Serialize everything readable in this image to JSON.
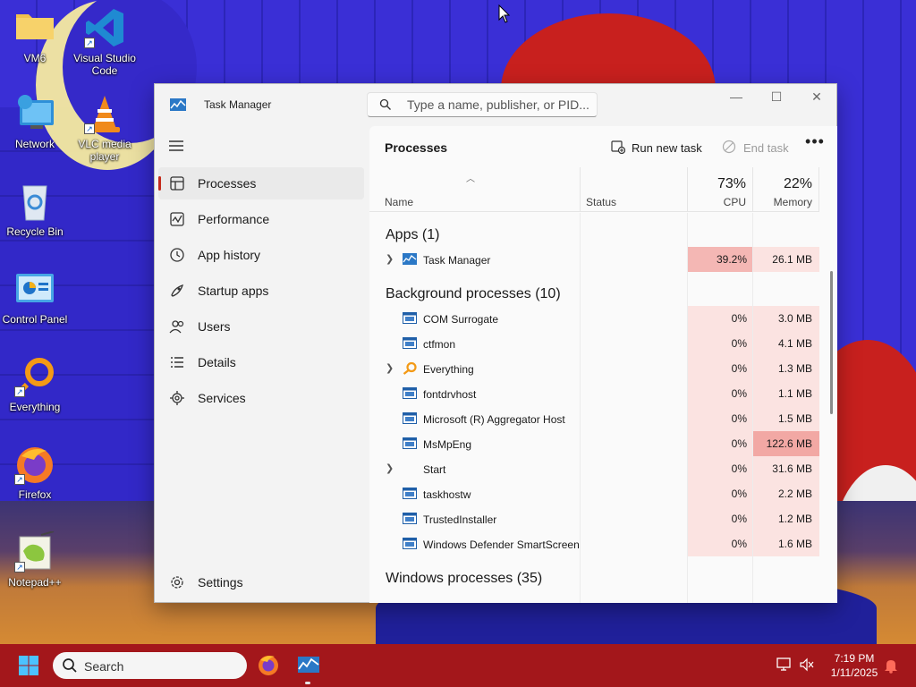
{
  "desktop": {
    "icons": [
      {
        "label": "VM6"
      },
      {
        "label": "Visual Studio Code"
      },
      {
        "label": "Network"
      },
      {
        "label": "VLC media player"
      },
      {
        "label": "Recycle Bin"
      },
      {
        "label": "Control Panel"
      },
      {
        "label": "Everything"
      },
      {
        "label": "Firefox"
      },
      {
        "label": "Notepad++"
      }
    ]
  },
  "window": {
    "title": "Task Manager",
    "search_placeholder": "Type a name, publisher, or PID...",
    "controls": {
      "minimize": "—",
      "maximize": "☐",
      "close": "✕"
    }
  },
  "sidebar": {
    "items": [
      {
        "label": "Processes",
        "icon": "processes-icon",
        "active": true
      },
      {
        "label": "Performance",
        "icon": "performance-icon"
      },
      {
        "label": "App history",
        "icon": "history-icon"
      },
      {
        "label": "Startup apps",
        "icon": "startup-icon"
      },
      {
        "label": "Users",
        "icon": "users-icon"
      },
      {
        "label": "Details",
        "icon": "details-icon"
      },
      {
        "label": "Services",
        "icon": "services-icon"
      }
    ],
    "settings_label": "Settings"
  },
  "content": {
    "page_title": "Processes",
    "run_new_task": "Run new task",
    "end_task": "End task",
    "more": "•••"
  },
  "table": {
    "headers": {
      "name": "Name",
      "status": "Status",
      "cpu_pct": "73%",
      "cpu": "CPU",
      "mem_pct": "22%",
      "memory": "Memory"
    },
    "groups": {
      "apps": "Apps (1)",
      "background": "Background processes (10)",
      "windows": "Windows processes (35)"
    },
    "apps": [
      {
        "name": "Task Manager",
        "cpu": "39.2%",
        "memory": "26.1 MB",
        "expandable": true,
        "icon": "taskmgr-icon"
      }
    ],
    "background": [
      {
        "name": "COM Surrogate",
        "cpu": "0%",
        "memory": "3.0 MB",
        "expandable": false,
        "icon": "window-app-icon"
      },
      {
        "name": "ctfmon",
        "cpu": "0%",
        "memory": "4.1 MB",
        "expandable": false,
        "icon": "window-app-icon"
      },
      {
        "name": "Everything",
        "cpu": "0%",
        "memory": "1.3 MB",
        "expandable": true,
        "icon": "magnifier-icon"
      },
      {
        "name": "fontdrvhost",
        "cpu": "0%",
        "memory": "1.1 MB",
        "expandable": false,
        "icon": "window-app-icon"
      },
      {
        "name": "Microsoft (R) Aggregator Host",
        "cpu": "0%",
        "memory": "1.5 MB",
        "expandable": false,
        "icon": "window-app-icon"
      },
      {
        "name": "MsMpEng",
        "cpu": "0%",
        "memory": "122.6 MB",
        "expandable": false,
        "icon": "window-app-icon"
      },
      {
        "name": "Start",
        "cpu": "0%",
        "memory": "31.6 MB",
        "expandable": true,
        "icon": ""
      },
      {
        "name": "taskhostw",
        "cpu": "0%",
        "memory": "2.2 MB",
        "expandable": false,
        "icon": "window-app-icon"
      },
      {
        "name": "TrustedInstaller",
        "cpu": "0%",
        "memory": "1.2 MB",
        "expandable": false,
        "icon": "window-app-icon"
      },
      {
        "name": "Windows Defender SmartScreen",
        "cpu": "0%",
        "memory": "1.6 MB",
        "expandable": false,
        "icon": "window-app-icon"
      }
    ]
  },
  "taskbar": {
    "search_label": "Search",
    "time": "7:19 PM",
    "date": "1/11/2025"
  },
  "colors": {
    "cpu_heavy": "#f4b7b4",
    "cpu_light": "#fbe3e1",
    "mem_heavy": "#f2a8a4",
    "accent": "#c42b1c",
    "taskbar": "#a3171b"
  }
}
